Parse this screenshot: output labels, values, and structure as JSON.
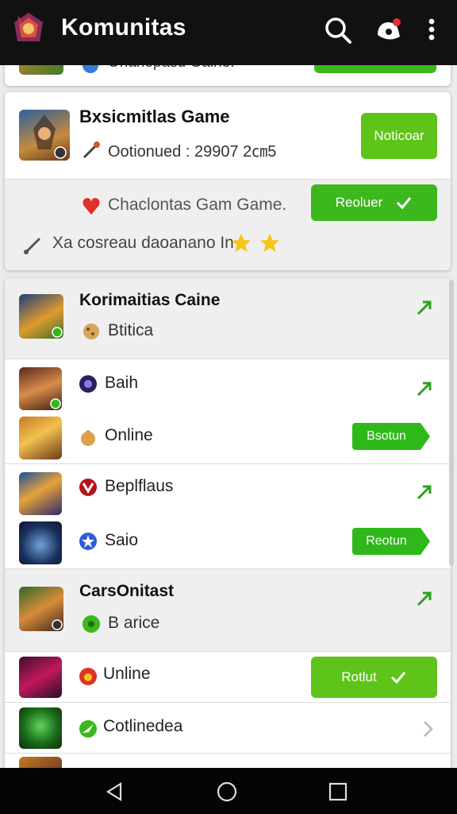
{
  "appbar": {
    "title": "Komunitas",
    "icons": [
      "app-logo-icon",
      "search-icon",
      "notification-icon",
      "more-vert-icon"
    ]
  },
  "colors": {
    "appbar": "#111111",
    "accent_green": "#3cb81e",
    "lime_green": "#5fc41a",
    "background": "#ececec"
  },
  "top_partial": {
    "text": "Onanopasu Gaine!"
  },
  "card1": {
    "title": "Bxsicmitlas Game",
    "subtitle": "Ootionued : 29907 2㎝5",
    "button": "Noticoar",
    "row2_text": "Chaclontas Gam Game.",
    "row2_button": "Reoluer",
    "row3_text": "Xa cosreau daoanano In"
  },
  "list": [
    {
      "title": "Korimaitias Caine",
      "sub": "Btitica"
    },
    {
      "title": "Baih"
    },
    {
      "title": "Online",
      "button": "Bsotun"
    },
    {
      "title": "Beplflaus"
    },
    {
      "title": "Saio",
      "button": "Reotun"
    },
    {
      "title": "CarsOnitast",
      "sub": "B arice"
    },
    {
      "title": "Unline",
      "button": "Rotlut"
    },
    {
      "title": "Cotlinedea"
    }
  ]
}
